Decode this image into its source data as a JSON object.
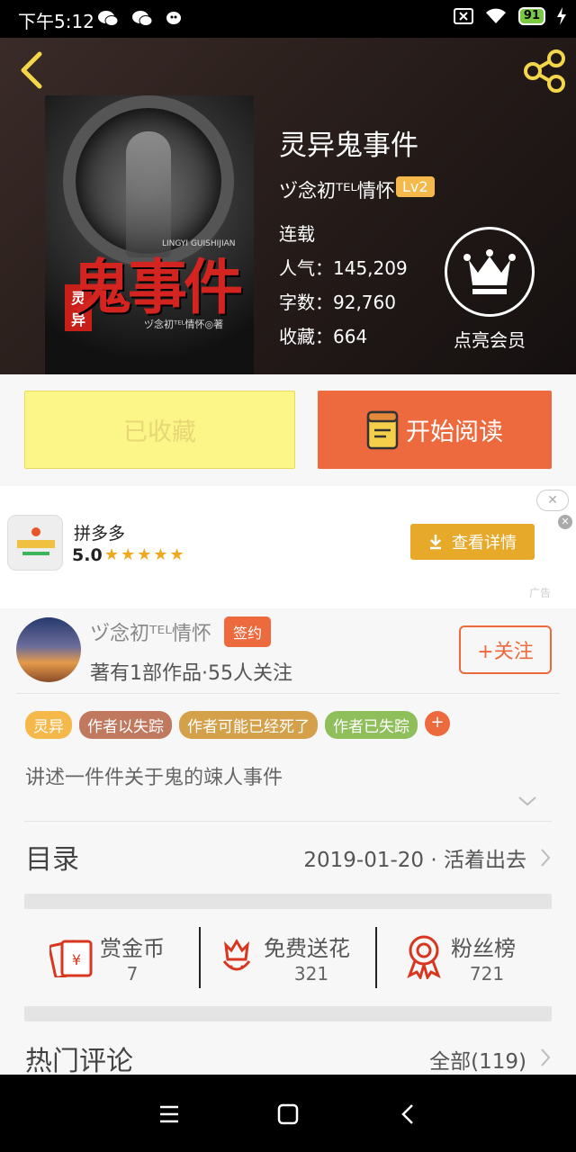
{
  "status_bar": {
    "time": "下午5:12",
    "battery": "91"
  },
  "book": {
    "title": "灵异鬼事件",
    "author": "ヅ念初ᵀᴱᴸ情怀",
    "level": "Lv2",
    "status": "连载",
    "popularity": "人气：145,209",
    "word_count": "字数：92,760",
    "favorites": "收藏：664",
    "vip_label": "点亮会员",
    "cover": {
      "title": "鬼事件",
      "tag": "灵异",
      "pinyin": "LINGYI GUISHIJIAN",
      "author": "ヅ念初ᵀᴱᴸ情怀◎著"
    }
  },
  "actions": {
    "collected_label": "已收藏",
    "read_label": "开始阅读"
  },
  "ad": {
    "app_name": "拼多多",
    "rating": "5.0",
    "stars": "★★★★★",
    "button_label": "查看详情",
    "ad_label": "广告"
  },
  "author_card": {
    "name": "ヅ念初ᵀᴱᴸ情怀",
    "badge": "签约",
    "stats": "著有1部作品·55人关注",
    "follow_label": "+关注"
  },
  "tags": [
    {
      "label": "灵异",
      "color": "#f5b84a"
    },
    {
      "label": "作者以失踪",
      "color": "#c0785e"
    },
    {
      "label": "作者可能已经死了",
      "color": "#d4a04a"
    },
    {
      "label": "作者已失踪",
      "color": "#8fbf5a"
    }
  ],
  "description": "讲述一件件关于鬼的竦人事件",
  "toc": {
    "label": "目录",
    "latest": "2019-01-20 · 活着出去"
  },
  "rewards": [
    {
      "label": "赏金币",
      "count": "7",
      "icon": "red-envelope-icon"
    },
    {
      "label": "免费送花",
      "count": "321",
      "icon": "flower-icon"
    },
    {
      "label": "粉丝榜",
      "count": "721",
      "icon": "medal-icon"
    }
  ],
  "comments": {
    "label": "热门评论",
    "all_label": "全部(119)"
  },
  "colors": {
    "accent": "#ec6a3d",
    "collect": "#fcf587",
    "gold": "#e6a92a"
  }
}
